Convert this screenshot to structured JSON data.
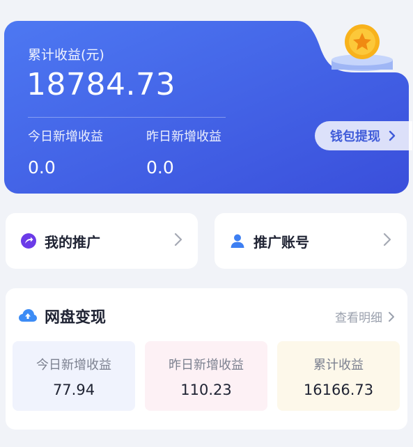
{
  "earnings": {
    "title": "累计收益(元)",
    "total": "18784.73",
    "today_label": "今日新增收益",
    "today_value": "0.0",
    "yesterday_label": "昨日新增收益",
    "yesterday_value": "0.0",
    "wallet_button": "钱包提现",
    "coin_icon": "coin-star-icon"
  },
  "promo": {
    "my_promotion": "我的推广",
    "promotion_account": "推广账号"
  },
  "netdisk": {
    "title": "网盘变现",
    "detail_link": "查看明细",
    "tiles": [
      {
        "label": "今日新增收益",
        "value": "77.94"
      },
      {
        "label": "昨日新增收益",
        "value": "110.23"
      },
      {
        "label": "累计收益",
        "value": "16166.73"
      }
    ]
  },
  "colors": {
    "card_gradient_start": "#4a72f0",
    "card_gradient_end": "#3a52dc",
    "accent_text": "#3f5bd9",
    "tile_1_bg": "#f0f3fd",
    "tile_2_bg": "#fdf1f5",
    "tile_3_bg": "#fdf8ea"
  }
}
